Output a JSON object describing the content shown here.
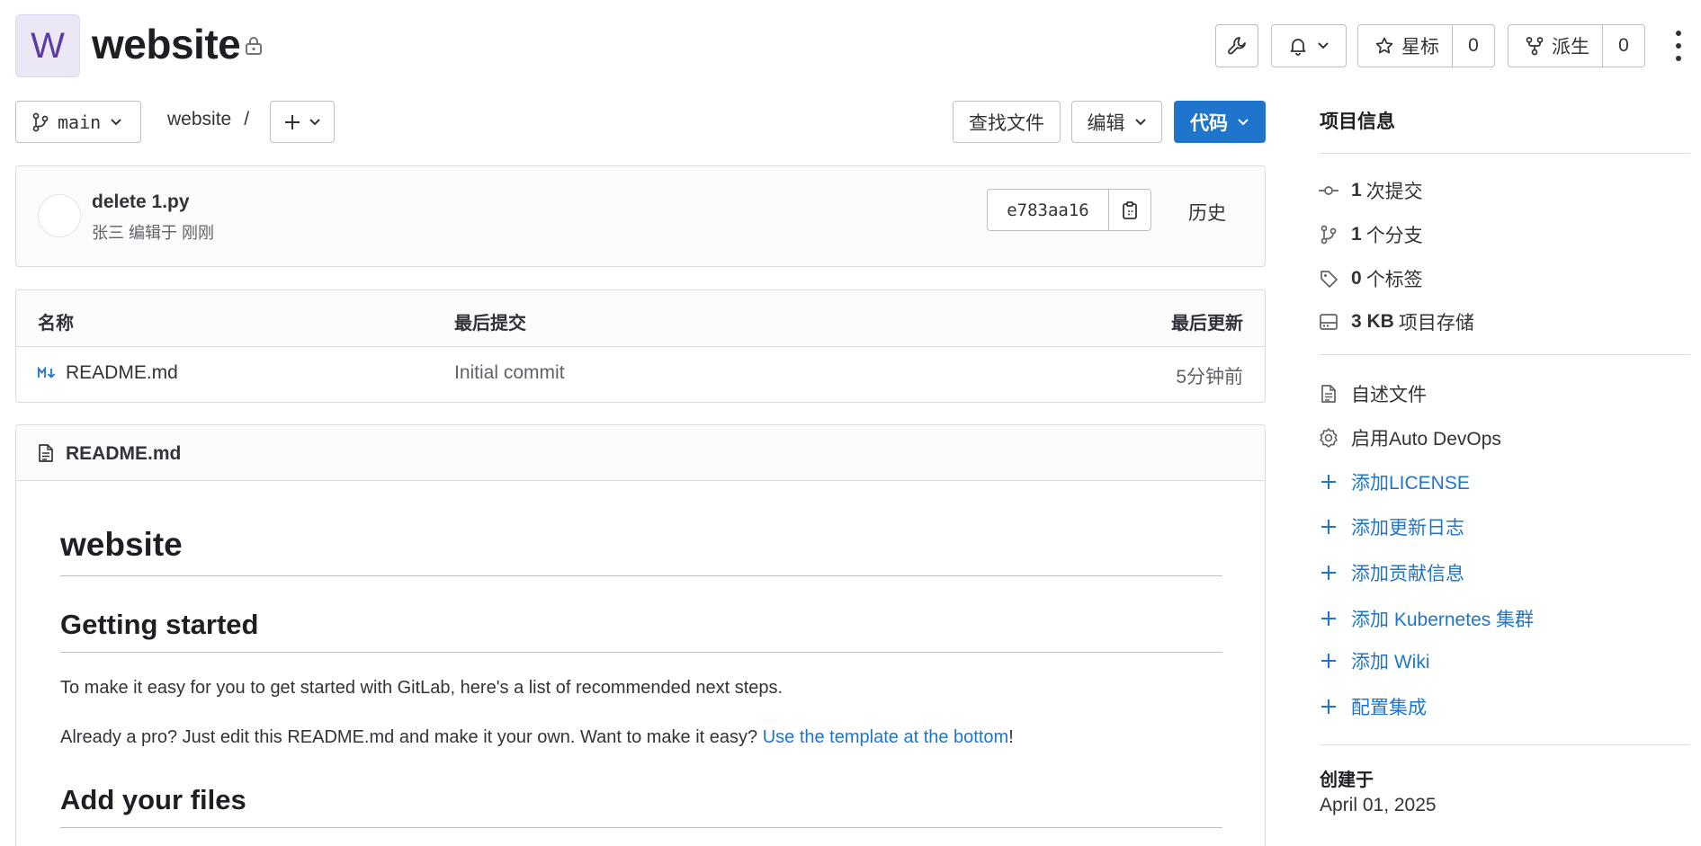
{
  "project": {
    "avatar_letter": "W",
    "name": "website"
  },
  "header_actions": {
    "star_label": "星标",
    "star_count": "0",
    "fork_label": "派生",
    "fork_count": "0"
  },
  "toolbar": {
    "branch": "main",
    "breadcrumb_root": "website",
    "breadcrumb_sep": "/",
    "find_file": "查找文件",
    "edit": "编辑",
    "code": "代码"
  },
  "last_commit": {
    "title": "delete 1.py",
    "author": "张三",
    "action": "编辑于",
    "time": "刚刚",
    "sha": "e783aa16",
    "history": "历史"
  },
  "file_table": {
    "headers": [
      "名称",
      "最后提交",
      "最后更新"
    ],
    "rows": [
      {
        "name": "README.md",
        "commit": "Initial commit",
        "updated": "5分钟前"
      }
    ]
  },
  "readme": {
    "filename": "README.md",
    "h1": "website",
    "h2_1": "Getting started",
    "p1": "To make it easy for you to get started with GitLab, here's a list of recommended next steps.",
    "p2_prefix": "Already a pro? Just edit this README.md and make it your own. Want to make it easy? ",
    "p2_link": "Use the template at the bottom",
    "p2_suffix": "!",
    "h2_2": "Add your files"
  },
  "sidebar": {
    "title": "项目信息",
    "stats": [
      {
        "icon": "commit-icon",
        "count": "1",
        "label": "次提交"
      },
      {
        "icon": "branch-icon",
        "count": "1",
        "label": "个分支"
      },
      {
        "icon": "tag-icon",
        "count": "0",
        "label": "个标签"
      },
      {
        "icon": "storage-icon",
        "count": "3 KB",
        "label": "项目存储"
      }
    ],
    "readme": "自述文件",
    "auto_devops": "启用Auto DevOps",
    "add_links": [
      "添加LICENSE",
      "添加更新日志",
      "添加贡献信息",
      "添加 Kubernetes 集群",
      "添加 Wiki",
      "配置集成"
    ],
    "created_label": "创建于",
    "created_date": "April 01, 2025"
  },
  "colors": {
    "primary": "#1f75cb",
    "avatar_bg": "#ebe7f5",
    "avatar_text": "#5b3ba3"
  }
}
